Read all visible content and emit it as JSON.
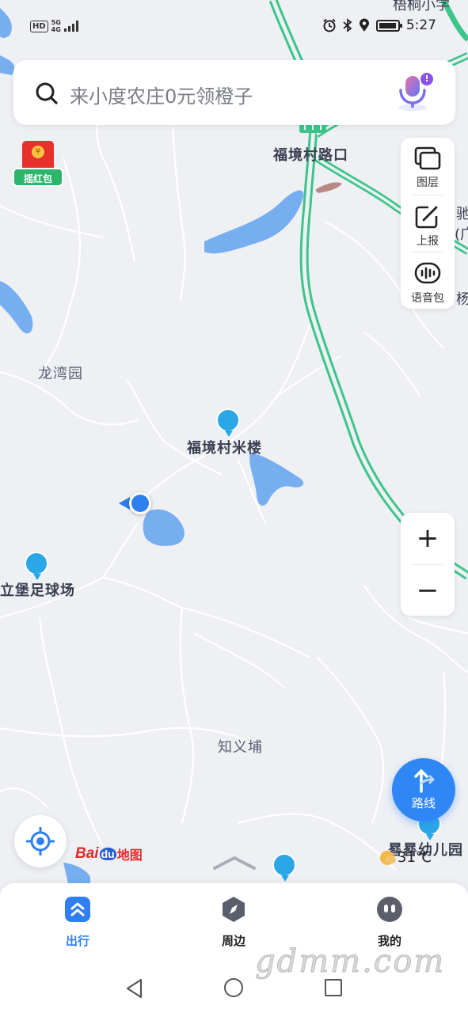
{
  "status_bar": {
    "hd": "HD",
    "network_top": "5G",
    "network_bottom": "4G",
    "time": "5:27"
  },
  "search": {
    "placeholder": "来小度农庄0元领橙子",
    "mic_badge": "!"
  },
  "red_packet": {
    "coin": "¥",
    "label": "摇红包"
  },
  "side_panel": {
    "layers": "图层",
    "report": "上报",
    "voice_pack": "语音包"
  },
  "zoom": {
    "in": "+",
    "out": "−"
  },
  "map_labels": {
    "top_school": "梧桐小学",
    "fujing_crossing": "福境村路口",
    "longwan": "龙湾园",
    "fujing_mi": "福境村米楼",
    "football": "立堡足球场",
    "zhiyi": "知义埔",
    "kindergarten": "晷晷幼儿园",
    "edge_chi": "驰",
    "edge_guang": "(广",
    "edge_yang": "杨"
  },
  "route_button": {
    "label": "路线"
  },
  "weather": {
    "temperature": "31℃"
  },
  "baidu_logo": {
    "bai": "Bai",
    "du": "du",
    "map": "地图"
  },
  "bottom_nav": {
    "tabs": [
      {
        "label": "出行",
        "icon": "double-chevron-up-icon",
        "active": true
      },
      {
        "label": "周边",
        "icon": "compass-icon",
        "active": false
      },
      {
        "label": "我的",
        "icon": "profile-face-icon",
        "active": false
      }
    ]
  },
  "watermark": "gdmm.com",
  "colors": {
    "accent": "#2f7ff0",
    "highway": "#3cc58a",
    "water": "#76aef0",
    "map_bg": "#eef0f4"
  }
}
